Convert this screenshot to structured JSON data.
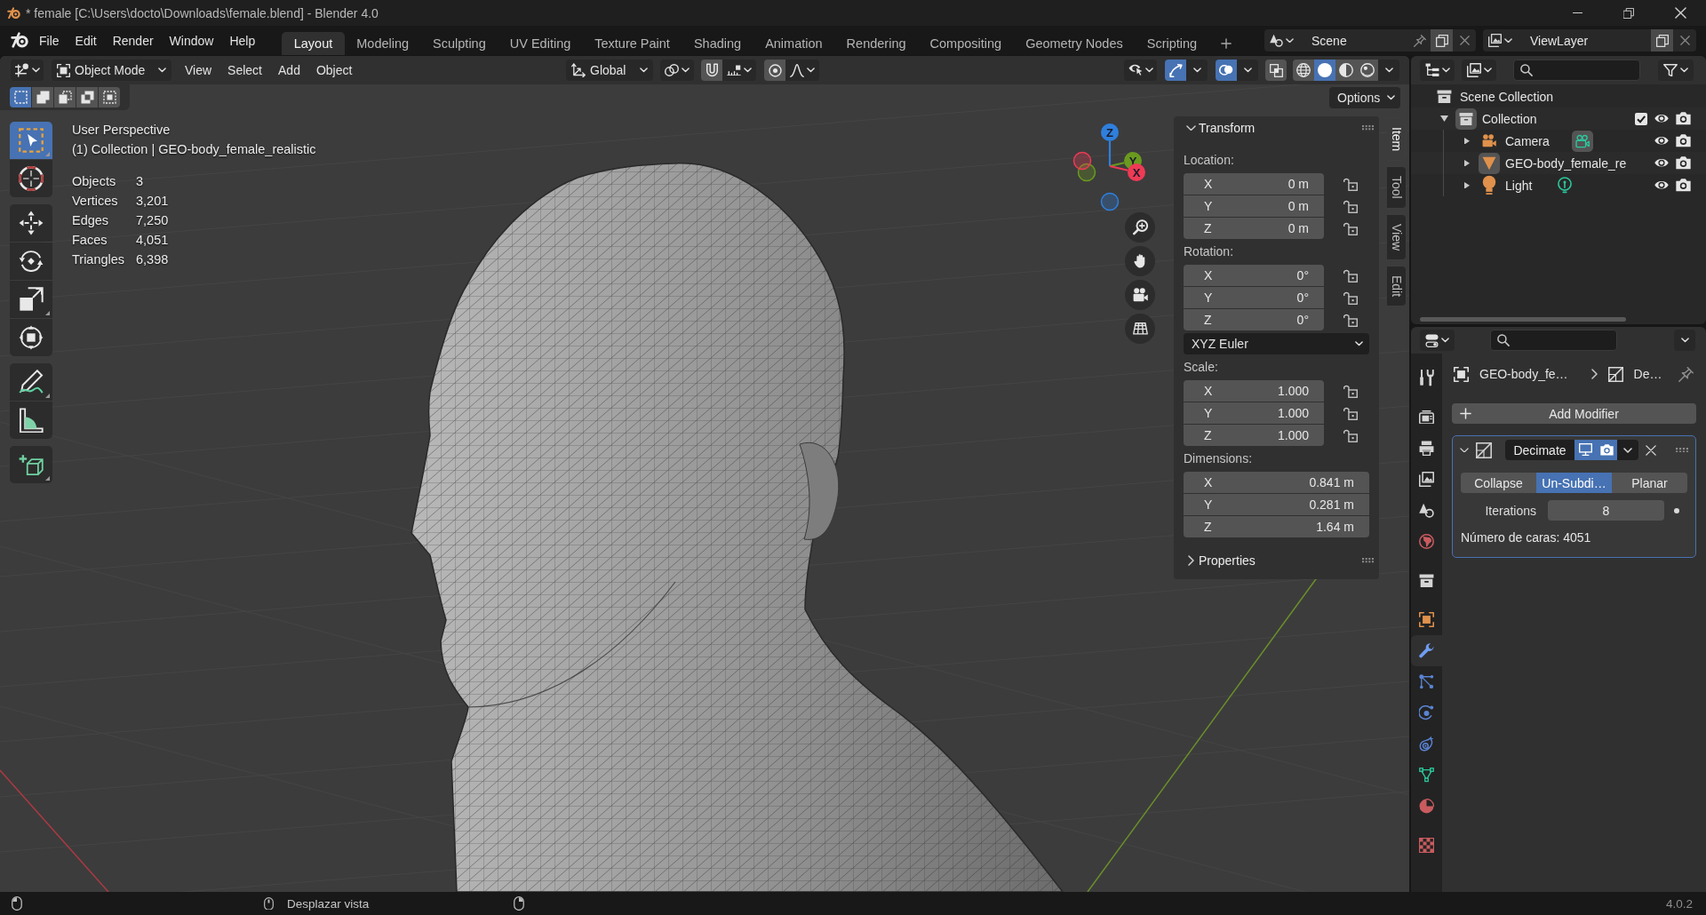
{
  "title_bar": {
    "title": "* female [C:\\Users\\docto\\Downloads\\female.blend] - Blender 4.0"
  },
  "top_bar": {
    "menus": [
      "File",
      "Edit",
      "Render",
      "Window",
      "Help"
    ],
    "workspaces": [
      {
        "label": "Layout",
        "selected": true
      },
      {
        "label": "Modeling",
        "selected": false
      },
      {
        "label": "Sculpting",
        "selected": false
      },
      {
        "label": "UV Editing",
        "selected": false
      },
      {
        "label": "Texture Paint",
        "selected": false
      },
      {
        "label": "Shading",
        "selected": false
      },
      {
        "label": "Animation",
        "selected": false
      },
      {
        "label": "Rendering",
        "selected": false
      },
      {
        "label": "Compositing",
        "selected": false
      },
      {
        "label": "Geometry Nodes",
        "selected": false
      },
      {
        "label": "Scripting",
        "selected": false
      }
    ],
    "scene": "Scene",
    "view_layer": "ViewLayer"
  },
  "viewport": {
    "header": {
      "mode": "Object Mode",
      "menus": [
        "View",
        "Select",
        "Add",
        "Object"
      ],
      "orientation": "Global",
      "snap": false,
      "proportional_editing": false,
      "gizmos": true,
      "overlays": true,
      "xray": false,
      "shading": [
        {
          "kind": "wireframe",
          "selected": false
        },
        {
          "kind": "solid",
          "selected": true
        },
        {
          "kind": "material",
          "selected": false
        },
        {
          "kind": "rendered",
          "selected": false
        }
      ]
    },
    "select_modes": [
      {
        "kind": "set",
        "selected": true
      },
      {
        "kind": "extend",
        "selected": false
      },
      {
        "kind": "subtract",
        "selected": false
      },
      {
        "kind": "invert",
        "selected": false
      },
      {
        "kind": "intersect",
        "selected": false
      }
    ],
    "options": "Options",
    "tool_groups": [
      {
        "tools": [
          {
            "kind": "select_box",
            "selected": true
          },
          {
            "kind": "cursor",
            "selected": false
          }
        ]
      },
      {
        "tools": [
          {
            "kind": "move",
            "selected": false
          },
          {
            "kind": "rotate",
            "selected": false
          },
          {
            "kind": "scale",
            "selected": false
          },
          {
            "kind": "transform",
            "selected": false
          }
        ]
      },
      {
        "tools": [
          {
            "kind": "annotate",
            "selected": false
          },
          {
            "kind": "measure",
            "selected": false
          }
        ]
      },
      {
        "tools": [
          {
            "kind": "add_cube",
            "selected": false
          }
        ]
      }
    ],
    "info": {
      "view": "User Perspective",
      "context": "(1) Collection | GEO-body_female_realistic",
      "stats": [
        {
          "label": "Objects",
          "value": "3"
        },
        {
          "label": "Vertices",
          "value": "3,201"
        },
        {
          "label": "Edges",
          "value": "7,250"
        },
        {
          "label": "Faces",
          "value": "4,051"
        },
        {
          "label": "Triangles",
          "value": "6,398"
        }
      ]
    },
    "axes": [
      {
        "label": "Z",
        "color": "#2f7fdc"
      },
      {
        "label": "Y",
        "color": "#6a9a1f"
      },
      {
        "label": "X",
        "color": "#ee3a55"
      }
    ]
  },
  "sidebar": {
    "panels": [
      {
        "title": "Transform",
        "expanded": true,
        "groups": [
          {
            "label": "Location:",
            "fields": [
              {
                "axis": "X",
                "value": "0 m",
                "locked": false
              },
              {
                "axis": "Y",
                "value": "0 m",
                "locked": false
              },
              {
                "axis": "Z",
                "value": "0 m",
                "locked": false
              }
            ]
          },
          {
            "label": "Rotation:",
            "fields": [
              {
                "axis": "X",
                "value": "0°",
                "locked": false
              },
              {
                "axis": "Y",
                "value": "0°",
                "locked": false
              },
              {
                "axis": "Z",
                "value": "0°",
                "locked": false
              }
            ],
            "mode": "XYZ Euler"
          },
          {
            "label": "Scale:",
            "fields": [
              {
                "axis": "X",
                "value": "1.000",
                "locked": false
              },
              {
                "axis": "Y",
                "value": "1.000",
                "locked": false
              },
              {
                "axis": "Z",
                "value": "1.000",
                "locked": false
              }
            ]
          },
          {
            "label": "Dimensions:",
            "fields": [
              {
                "axis": "X",
                "value": "0.841 m"
              },
              {
                "axis": "Y",
                "value": "0.281 m"
              },
              {
                "axis": "Z",
                "value": "1.64 m"
              }
            ]
          }
        ]
      },
      {
        "title": "Properties",
        "expanded": false
      }
    ],
    "tabs": [
      {
        "label": "Item",
        "selected": true
      },
      {
        "label": "Tool",
        "selected": false
      },
      {
        "label": "View",
        "selected": false
      },
      {
        "label": "Edit",
        "selected": false
      }
    ]
  },
  "outliner": {
    "tree": [
      {
        "name": "Scene Collection",
        "kind": "scene_collection",
        "children": [
          {
            "name": "Collection",
            "kind": "collection",
            "expanded": true,
            "active": true,
            "checked": true,
            "visible": true,
            "renderable": true,
            "children": [
              {
                "name": "Camera",
                "kind": "camera",
                "expanded": false,
                "active": false,
                "data_active": true,
                "visible": true,
                "renderable": true
              },
              {
                "name": "GEO-body_female_re",
                "kind": "mesh",
                "expanded": false,
                "active": true,
                "visible": true,
                "renderable": true
              },
              {
                "name": "Light",
                "kind": "light",
                "expanded": false,
                "active": false,
                "data_active": false,
                "visible": true,
                "renderable": true
              }
            ]
          }
        ]
      }
    ]
  },
  "properties": {
    "tab_groups": [
      {
        "tabs": [
          {
            "kind": "tool",
            "selected": false
          }
        ]
      },
      {
        "tabs": [
          {
            "kind": "render",
            "selected": false
          },
          {
            "kind": "output",
            "selected": false
          },
          {
            "kind": "view_layer",
            "selected": false
          },
          {
            "kind": "scene",
            "selected": false
          },
          {
            "kind": "world",
            "selected": false
          }
        ]
      },
      {
        "tabs": [
          {
            "kind": "collection",
            "selected": false
          }
        ]
      },
      {
        "tabs": [
          {
            "kind": "object",
            "selected": false
          },
          {
            "kind": "modifiers",
            "selected": true
          },
          {
            "kind": "particles",
            "selected": false
          },
          {
            "kind": "physics",
            "selected": false
          },
          {
            "kind": "constraints",
            "selected": false
          },
          {
            "kind": "data",
            "selected": false
          },
          {
            "kind": "material",
            "selected": false
          }
        ]
      },
      {
        "tabs": [
          {
            "kind": "texture",
            "selected": false
          }
        ]
      }
    ],
    "breadcrumb": {
      "object": "GEO-body_fe…",
      "modifier": "De…"
    },
    "add_modifier": "Add Modifier",
    "modifiers": [
      {
        "name": "Decimate",
        "expanded": true,
        "show_viewport": true,
        "show_render": true,
        "modes": [
          {
            "label": "Collapse",
            "selected": false
          },
          {
            "label": "Un-Subdi…",
            "selected": true
          },
          {
            "label": "Planar",
            "selected": false
          }
        ],
        "iterations": {
          "label": "Iterations",
          "value": "8"
        },
        "info": "Número de caras: 4051"
      }
    ]
  },
  "status_bar": {
    "hint": "Desplazar vista",
    "version": "4.0.2"
  }
}
